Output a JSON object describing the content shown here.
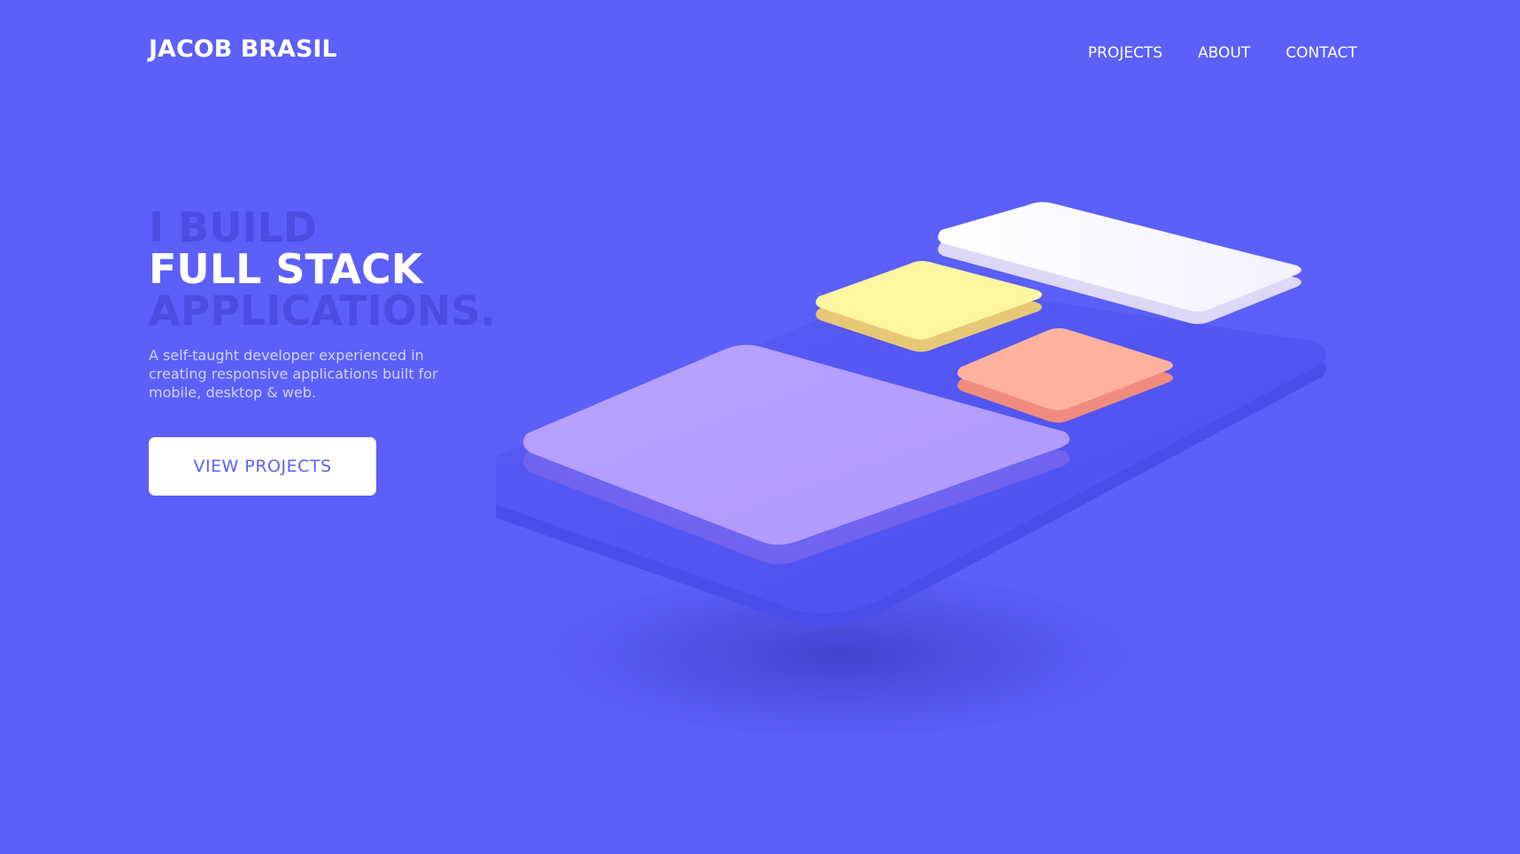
{
  "header": {
    "brand": "JACOB BRASIL",
    "nav": [
      "PROJECTS",
      "ABOUT",
      "CONTACT"
    ]
  },
  "hero": {
    "line1": "I BUILD",
    "line2": "FULL STACK",
    "line3": "APPLICATIONS.",
    "description": "A self-taught developer experienced in creating responsive applications built for mobile, desktop & web.",
    "cta_label": "VIEW PROJECTS"
  },
  "colors": {
    "background": "#5c5ff8",
    "heading_muted": "#4a4de0",
    "heading_bright": "#ffffff",
    "card_white": "#ffffff",
    "card_yellow": "#fdf7a0",
    "card_salmon": "#ffb29e",
    "card_lavender": "#b69cff",
    "phone_base": "#5455f0"
  },
  "illustration": {
    "name": "isometric-phone-ui-illustration"
  }
}
